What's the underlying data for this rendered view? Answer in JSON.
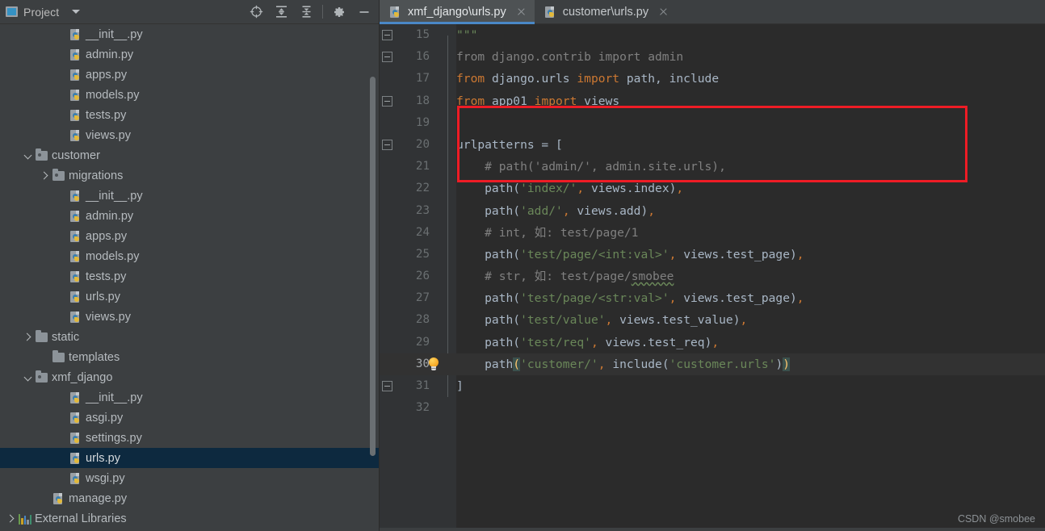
{
  "project_pane": {
    "title": "Project",
    "icons": {
      "project": "project-window-icon",
      "dropdown": "chevron-down-icon",
      "locate": "locate-target-icon",
      "expand_all": "expand-all-icon",
      "collapse_all": "collapse-all-icon",
      "settings": "gear-icon",
      "hide": "minimize-icon"
    },
    "tree": [
      {
        "label": "__init__.py",
        "type": "py",
        "indent": 3,
        "arrow": "none",
        "selected": false
      },
      {
        "label": "admin.py",
        "type": "py",
        "indent": 3,
        "arrow": "none",
        "selected": false
      },
      {
        "label": "apps.py",
        "type": "py",
        "indent": 3,
        "arrow": "none",
        "selected": false
      },
      {
        "label": "models.py",
        "type": "py",
        "indent": 3,
        "arrow": "none",
        "selected": false
      },
      {
        "label": "tests.py",
        "type": "py",
        "indent": 3,
        "arrow": "none",
        "selected": false
      },
      {
        "label": "views.py",
        "type": "py",
        "indent": 3,
        "arrow": "none",
        "selected": false
      },
      {
        "label": "customer",
        "type": "module",
        "indent": 1,
        "arrow": "open",
        "selected": false
      },
      {
        "label": "migrations",
        "type": "module",
        "indent": 2,
        "arrow": "closed",
        "selected": false
      },
      {
        "label": "__init__.py",
        "type": "py",
        "indent": 3,
        "arrow": "none",
        "selected": false
      },
      {
        "label": "admin.py",
        "type": "py",
        "indent": 3,
        "arrow": "none",
        "selected": false
      },
      {
        "label": "apps.py",
        "type": "py",
        "indent": 3,
        "arrow": "none",
        "selected": false
      },
      {
        "label": "models.py",
        "type": "py",
        "indent": 3,
        "arrow": "none",
        "selected": false
      },
      {
        "label": "tests.py",
        "type": "py",
        "indent": 3,
        "arrow": "none",
        "selected": false
      },
      {
        "label": "urls.py",
        "type": "py",
        "indent": 3,
        "arrow": "none",
        "selected": false
      },
      {
        "label": "views.py",
        "type": "py",
        "indent": 3,
        "arrow": "none",
        "selected": false
      },
      {
        "label": "static",
        "type": "folder",
        "indent": 1,
        "arrow": "closed",
        "selected": false
      },
      {
        "label": "templates",
        "type": "folder",
        "indent": 2,
        "arrow": "none",
        "selected": false
      },
      {
        "label": "xmf_django",
        "type": "module",
        "indent": 1,
        "arrow": "open",
        "selected": false
      },
      {
        "label": "__init__.py",
        "type": "py",
        "indent": 3,
        "arrow": "none",
        "selected": false
      },
      {
        "label": "asgi.py",
        "type": "py",
        "indent": 3,
        "arrow": "none",
        "selected": false
      },
      {
        "label": "settings.py",
        "type": "py",
        "indent": 3,
        "arrow": "none",
        "selected": false
      },
      {
        "label": "urls.py",
        "type": "py",
        "indent": 3,
        "arrow": "none",
        "selected": true
      },
      {
        "label": "wsgi.py",
        "type": "py",
        "indent": 3,
        "arrow": "none",
        "selected": false
      },
      {
        "label": "manage.py",
        "type": "py",
        "indent": 2,
        "arrow": "none",
        "selected": false
      },
      {
        "label": "External Libraries",
        "type": "lib",
        "indent": 0,
        "arrow": "closed",
        "selected": false
      }
    ]
  },
  "editor": {
    "tabs": [
      {
        "label": "xmf_django\\urls.py",
        "active": true,
        "icon": "python-file-icon",
        "close": "close-icon"
      },
      {
        "label": "customer\\urls.py",
        "active": false,
        "icon": "python-file-icon",
        "close": "close-icon"
      }
    ],
    "current_line": 30,
    "lines": [
      {
        "n": "15",
        "fold": "mid",
        "parts": [
          {
            "t": "\"\"\"",
            "c": "s"
          }
        ]
      },
      {
        "n": "16",
        "fold": "start",
        "parts": [
          {
            "t": "from django.contrib import admin",
            "c": "g"
          }
        ]
      },
      {
        "n": "17",
        "fold": "none",
        "parts": [
          {
            "t": "from ",
            "c": "k"
          },
          {
            "t": "django.urls ",
            "c": "fn"
          },
          {
            "t": "import ",
            "c": "k"
          },
          {
            "t": "path, include",
            "c": "fn"
          }
        ]
      },
      {
        "n": "18",
        "fold": "end",
        "parts": [
          {
            "t": "from ",
            "c": "k"
          },
          {
            "t": "app01 ",
            "c": "fn"
          },
          {
            "t": "import ",
            "c": "k"
          },
          {
            "t": "views",
            "c": "fn"
          }
        ]
      },
      {
        "n": "19",
        "fold": "none",
        "parts": []
      },
      {
        "n": "20",
        "fold": "start",
        "parts": [
          {
            "t": "urlpatterns = [",
            "c": "fn"
          }
        ]
      },
      {
        "n": "21",
        "fold": "none",
        "parts": [
          {
            "t": "    # path('admin/', admin.site.urls),",
            "c": "c"
          }
        ]
      },
      {
        "n": "22",
        "fold": "none",
        "parts": [
          {
            "t": "    path",
            "c": "fn"
          },
          {
            "t": "(",
            "c": "pun"
          },
          {
            "t": "'index/'",
            "c": "s"
          },
          {
            "t": ",",
            "c": "orange-comma"
          },
          {
            "t": " views.index",
            "c": "fn"
          },
          {
            "t": ")",
            "c": "pun"
          },
          {
            "t": ",",
            "c": "orange-comma"
          }
        ]
      },
      {
        "n": "23",
        "fold": "none",
        "parts": [
          {
            "t": "    path",
            "c": "fn"
          },
          {
            "t": "(",
            "c": "pun"
          },
          {
            "t": "'add/'",
            "c": "s"
          },
          {
            "t": ",",
            "c": "orange-comma"
          },
          {
            "t": " views.add",
            "c": "fn"
          },
          {
            "t": ")",
            "c": "pun"
          },
          {
            "t": ",",
            "c": "orange-comma"
          }
        ]
      },
      {
        "n": "24",
        "fold": "none",
        "parts": [
          {
            "t": "    # int, 如: test/page/1",
            "c": "c"
          }
        ]
      },
      {
        "n": "25",
        "fold": "none",
        "parts": [
          {
            "t": "    path",
            "c": "fn"
          },
          {
            "t": "(",
            "c": "pun"
          },
          {
            "t": "'test/page/<int:val>'",
            "c": "s"
          },
          {
            "t": ",",
            "c": "orange-comma"
          },
          {
            "t": " views.test_page",
            "c": "fn"
          },
          {
            "t": ")",
            "c": "pun"
          },
          {
            "t": ",",
            "c": "orange-comma"
          }
        ]
      },
      {
        "n": "26",
        "fold": "none",
        "parts": [
          {
            "t": "    # str, 如: test/page/",
            "c": "c"
          },
          {
            "t": "smobee",
            "c": "c spell"
          }
        ]
      },
      {
        "n": "27",
        "fold": "none",
        "parts": [
          {
            "t": "    path",
            "c": "fn"
          },
          {
            "t": "(",
            "c": "pun"
          },
          {
            "t": "'test/page/<str:val>'",
            "c": "s"
          },
          {
            "t": ",",
            "c": "orange-comma"
          },
          {
            "t": " views.test_page",
            "c": "fn"
          },
          {
            "t": ")",
            "c": "pun"
          },
          {
            "t": ",",
            "c": "orange-comma"
          }
        ]
      },
      {
        "n": "28",
        "fold": "none",
        "parts": [
          {
            "t": "    path",
            "c": "fn"
          },
          {
            "t": "(",
            "c": "pun"
          },
          {
            "t": "'test/value'",
            "c": "s"
          },
          {
            "t": ",",
            "c": "orange-comma"
          },
          {
            "t": " views.test_value",
            "c": "fn"
          },
          {
            "t": ")",
            "c": "pun"
          },
          {
            "t": ",",
            "c": "orange-comma"
          }
        ]
      },
      {
        "n": "29",
        "fold": "none",
        "parts": [
          {
            "t": "    path",
            "c": "fn"
          },
          {
            "t": "(",
            "c": "pun"
          },
          {
            "t": "'test/req'",
            "c": "s"
          },
          {
            "t": ",",
            "c": "orange-comma"
          },
          {
            "t": " views.test_req",
            "c": "fn"
          },
          {
            "t": ")",
            "c": "pun"
          },
          {
            "t": ",",
            "c": "orange-comma"
          }
        ]
      },
      {
        "n": "30",
        "fold": "none",
        "parts": [
          {
            "t": "    path",
            "c": "fn"
          },
          {
            "t": "(",
            "c": "brk"
          },
          {
            "t": "'customer/'",
            "c": "s"
          },
          {
            "t": ",",
            "c": "orange-comma"
          },
          {
            "t": " include",
            "c": "fn"
          },
          {
            "t": "(",
            "c": "pun"
          },
          {
            "t": "'customer.urls'",
            "c": "s"
          },
          {
            "t": ")",
            "c": "pun"
          },
          {
            "t": ")",
            "c": "brk"
          }
        ]
      },
      {
        "n": "31",
        "fold": "end",
        "parts": [
          {
            "t": "]",
            "c": "fn"
          }
        ]
      },
      {
        "n": "32",
        "fold": "none",
        "parts": []
      }
    ],
    "gutter_hint": {
      "icon": "lightbulb-icon",
      "line": 30
    },
    "annotation": {
      "name": "red-highlight-rectangle",
      "color": "#ee1c25"
    },
    "watermark": "CSDN @smobee"
  },
  "colors": {
    "keyword": "#cc7832",
    "string": "#6a8759",
    "comment": "#808080",
    "text": "#a9b7c6",
    "selection": "#0d293f",
    "accent": "#4a88c7",
    "annotation": "#ee1c25"
  }
}
